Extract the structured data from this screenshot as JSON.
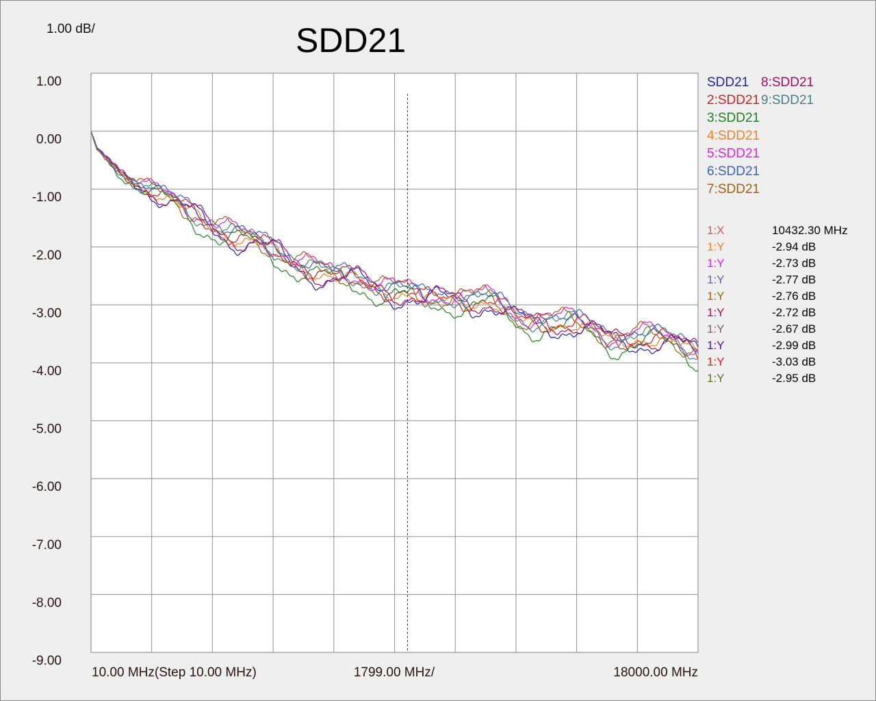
{
  "scale_label": "1.00 dB/",
  "chart_data": {
    "type": "line",
    "title": "SDD21",
    "x_unit": "MHz",
    "xlim": [
      10,
      20000
    ],
    "ylim": [
      -9,
      1
    ],
    "y_ticks": [
      "1.00",
      "0.00",
      "-1.00",
      "-2.00",
      "-3.00",
      "-4.00",
      "-5.00",
      "-6.00",
      "-7.00",
      "-8.00",
      "-9.00"
    ],
    "x_labels": {
      "left": "10.00 MHz(Step 10.00 MHz)",
      "center": "1799.00 MHz/",
      "right": "18000.00 MHz"
    },
    "grid": true,
    "legend_position": "right",
    "marker_freq_mhz": 10432.3,
    "base_curve": {
      "x": [
        10,
        200,
        1000,
        2000,
        3000,
        4000,
        5000,
        6000,
        7000,
        8000,
        9000,
        10000,
        11000,
        12000,
        13000,
        14000,
        15000,
        16000,
        17000,
        18000,
        19000,
        20000
      ],
      "y": [
        0.0,
        -0.3,
        -0.72,
        -1.0,
        -1.33,
        -1.55,
        -1.85,
        -2.05,
        -2.25,
        -2.55,
        -2.55,
        -2.7,
        -2.95,
        -2.8,
        -2.9,
        -3.25,
        -3.2,
        -3.35,
        -3.55,
        -3.5,
        -3.65,
        -3.75
      ]
    },
    "series": [
      {
        "name": "SDD21",
        "color": "#2020a8",
        "offset": -0.08,
        "ripple": 0.22,
        "phase": 0.3
      },
      {
        "name": "2:SDD21",
        "color": "#d02020",
        "offset": -0.02,
        "ripple": 0.2,
        "phase": 1.1
      },
      {
        "name": "3:SDD21",
        "color": "#208020",
        "offset": -0.12,
        "ripple": 0.24,
        "phase": 2.0
      },
      {
        "name": "4:SDD21",
        "color": "#f08020",
        "offset": -0.05,
        "ripple": 0.12,
        "phase": 0.7
      },
      {
        "name": "5:SDD21",
        "color": "#e020e0",
        "offset": 0.05,
        "ripple": 0.16,
        "phase": 2.6
      },
      {
        "name": "6:SDD21",
        "color": "#3a60c8",
        "offset": 0.08,
        "ripple": 0.14,
        "phase": 1.5
      },
      {
        "name": "7:SDD21",
        "color": "#a06010",
        "offset": 0.02,
        "ripple": 0.15,
        "phase": 3.1
      },
      {
        "name": "8:SDD21",
        "color": "#a01060",
        "offset": -0.03,
        "ripple": 0.18,
        "phase": 0.1
      },
      {
        "name": "9:SDD21",
        "color": "#4a8080",
        "offset": 0.0,
        "ripple": 0.17,
        "phase": 2.2
      }
    ]
  },
  "markers": [
    {
      "id": "1:X",
      "id_color": "#c06060",
      "value": "10432.30 MHz"
    },
    {
      "id": "1:Y",
      "id_color": "#f08020",
      "value": "-2.94 dB"
    },
    {
      "id": "1:Y",
      "id_color": "#e020e0",
      "value": "-2.73 dB"
    },
    {
      "id": "1:Y",
      "id_color": "#6060b0",
      "value": "-2.77 dB"
    },
    {
      "id": "1:Y",
      "id_color": "#a06010",
      "value": "-2.76 dB"
    },
    {
      "id": "1:Y",
      "id_color": "#a01060",
      "value": "-2.72 dB"
    },
    {
      "id": "1:Y",
      "id_color": "#806060",
      "value": "-2.67 dB"
    },
    {
      "id": "1:Y",
      "id_color": "#5010a0",
      "value": "-2.99 dB"
    },
    {
      "id": "1:Y",
      "id_color": "#d02020",
      "value": "-3.03 dB"
    },
    {
      "id": "1:Y",
      "id_color": "#607020",
      "value": "-2.95 dB"
    }
  ]
}
